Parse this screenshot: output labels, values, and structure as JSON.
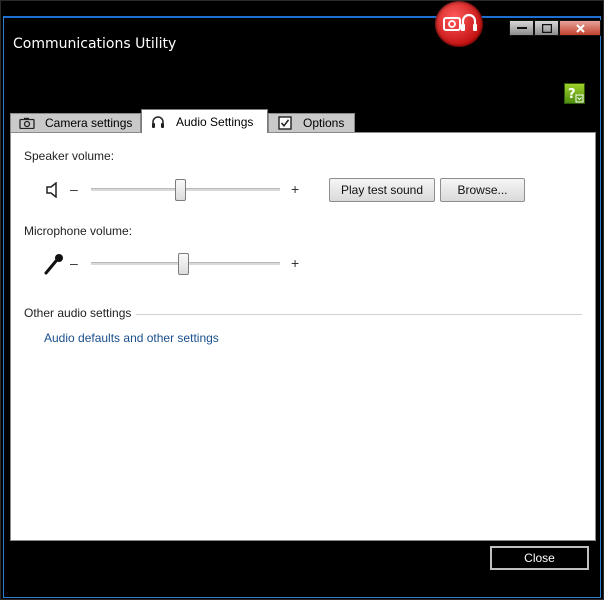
{
  "window": {
    "title": "Communications Utility"
  },
  "tabs": [
    {
      "label": "Camera settings",
      "icon": "camera-icon"
    },
    {
      "label": "Audio Settings",
      "icon": "headset-icon"
    },
    {
      "label": "Options",
      "icon": "checkbox-icon"
    }
  ],
  "speaker": {
    "label": "Speaker volume:",
    "minus": "–",
    "plus": "+",
    "level": 0.47,
    "play_button": "Play test sound",
    "browse_button": "Browse..."
  },
  "microphone": {
    "label": "Microphone volume:",
    "minus": "–",
    "plus": "+",
    "level": 0.49
  },
  "other": {
    "heading": "Other audio settings",
    "link": "Audio defaults and other settings"
  },
  "footer": {
    "close_button": "Close"
  },
  "colors": {
    "link": "#1a4f8c",
    "help_green": "#7bb31a",
    "logo_red": "#d11b1b"
  }
}
